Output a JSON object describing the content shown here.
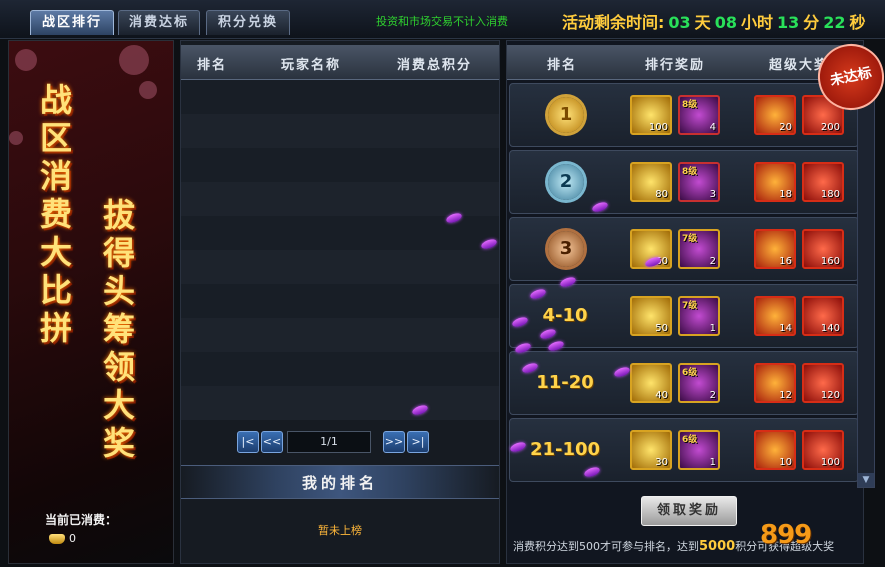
{
  "tabs": [
    {
      "label": "战区排行",
      "active": true
    },
    {
      "label": "消费达标",
      "active": false
    },
    {
      "label": "积分兑换",
      "active": false
    }
  ],
  "notice": "投资和市场交易不计入消费",
  "timer": {
    "label": "活动剩余时间:",
    "days": "03",
    "days_unit": "天",
    "hours": "08",
    "hours_unit": "小时",
    "minutes": "13",
    "minutes_unit": "分",
    "seconds": "22",
    "seconds_unit": "秒"
  },
  "banner": {
    "title_left": "战区消费大比拼",
    "title_right": "拔得头筹领大奖",
    "spent_label": "当前已消费：",
    "spent_value": "0"
  },
  "ranking_table": {
    "columns": [
      "排名",
      "玩家名称",
      "消费总积分"
    ],
    "rows": [],
    "pager": {
      "first": "|<",
      "prev": "<<",
      "page": "1/1",
      "next": ">>",
      "last": ">|"
    },
    "my_rank_title": "我的排名",
    "my_rank_value": "暂未上榜"
  },
  "rewards": {
    "columns": [
      "排名",
      "排行奖励",
      "超级大奖"
    ],
    "stamp": "未达标",
    "rows": [
      {
        "rank": "1",
        "medal": "gold",
        "leaf": "100",
        "book_level": "8级",
        "book": "4",
        "red_a": "20",
        "red_b": "200"
      },
      {
        "rank": "2",
        "medal": "silver",
        "leaf": "80",
        "book_level": "8级",
        "book": "3",
        "red_a": "18",
        "red_b": "180"
      },
      {
        "rank": "3",
        "medal": "bronze",
        "leaf": "60",
        "book_level": "7级",
        "book": "2",
        "red_a": "16",
        "red_b": "160"
      },
      {
        "rank": "4-10",
        "medal": "",
        "leaf": "50",
        "book_level": "7级",
        "book": "1",
        "red_a": "14",
        "red_b": "140"
      },
      {
        "rank": "11-20",
        "medal": "",
        "leaf": "40",
        "book_level": "6级",
        "book": "2",
        "red_a": "12",
        "red_b": "120"
      },
      {
        "rank": "21-100",
        "medal": "",
        "leaf": "30",
        "book_level": "6级",
        "book": "1",
        "red_a": "10",
        "red_b": "100"
      }
    ],
    "claim_label": "领取奖励",
    "note_prefix": "消费积分达到500才可参与排名，达到",
    "note_highlight": "5000",
    "note_suffix": "积分可获得超级大奖"
  },
  "watermark": "899"
}
